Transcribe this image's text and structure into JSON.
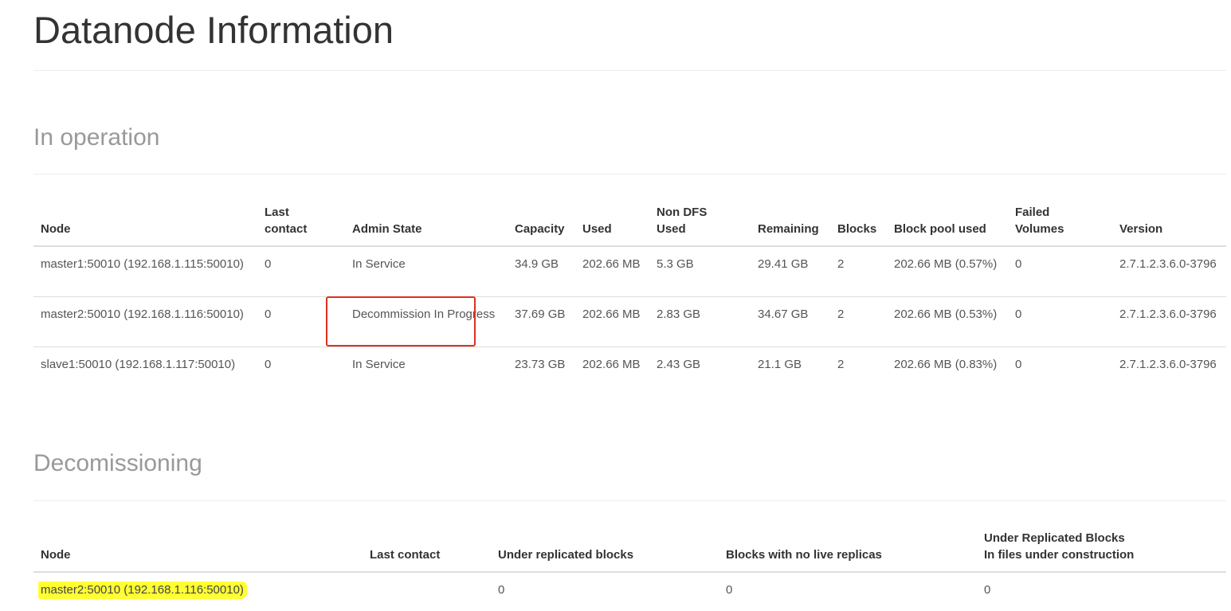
{
  "page": {
    "title": "Datanode Information"
  },
  "in_operation": {
    "title": "In operation",
    "columns": [
      "Node",
      "Last\ncontact",
      "Admin State",
      "Capacity",
      "Used",
      "Non DFS\nUsed",
      "Remaining",
      "Blocks",
      "Block pool used",
      "Failed\nVolumes",
      "Version"
    ],
    "rows": [
      {
        "node": "master1:50010 (192.168.1.115:50010)",
        "last_contact": "0",
        "admin_state": "In Service",
        "capacity": "34.9 GB",
        "used": "202.66 MB",
        "non_dfs_used": "5.3 GB",
        "remaining": "29.41 GB",
        "blocks": "2",
        "block_pool_used": "202.66 MB (0.57%)",
        "failed_volumes": "0",
        "version": "2.7.1.2.3.6.0-3796"
      },
      {
        "node": "master2:50010 (192.168.1.116:50010)",
        "last_contact": "0",
        "admin_state": "Decommission In Progress",
        "capacity": "37.69 GB",
        "used": "202.66 MB",
        "non_dfs_used": "2.83 GB",
        "remaining": "34.67 GB",
        "blocks": "2",
        "block_pool_used": "202.66 MB (0.53%)",
        "failed_volumes": "0",
        "version": "2.7.1.2.3.6.0-3796"
      },
      {
        "node": "slave1:50010 (192.168.1.117:50010)",
        "last_contact": "0",
        "admin_state": "In Service",
        "capacity": "23.73 GB",
        "used": "202.66 MB",
        "non_dfs_used": "2.43 GB",
        "remaining": "21.1 GB",
        "blocks": "2",
        "block_pool_used": "202.66 MB (0.83%)",
        "failed_volumes": "0",
        "version": "2.7.1.2.3.6.0-3796"
      }
    ]
  },
  "decommissioning": {
    "title": "Decomissioning",
    "columns": [
      "Node",
      "Last contact",
      "Under replicated blocks",
      "Blocks with no live replicas",
      "Under Replicated Blocks\nIn files under construction"
    ],
    "rows": [
      {
        "node": "master2:50010 (192.168.1.116:50010)",
        "last_contact": "",
        "under_replicated_blocks": "0",
        "blocks_no_live_replicas": "0",
        "under_replicated_in_construction": "0"
      }
    ]
  },
  "annotations": {
    "box_color": "#e0301e",
    "highlight_color": "#ffff33"
  }
}
